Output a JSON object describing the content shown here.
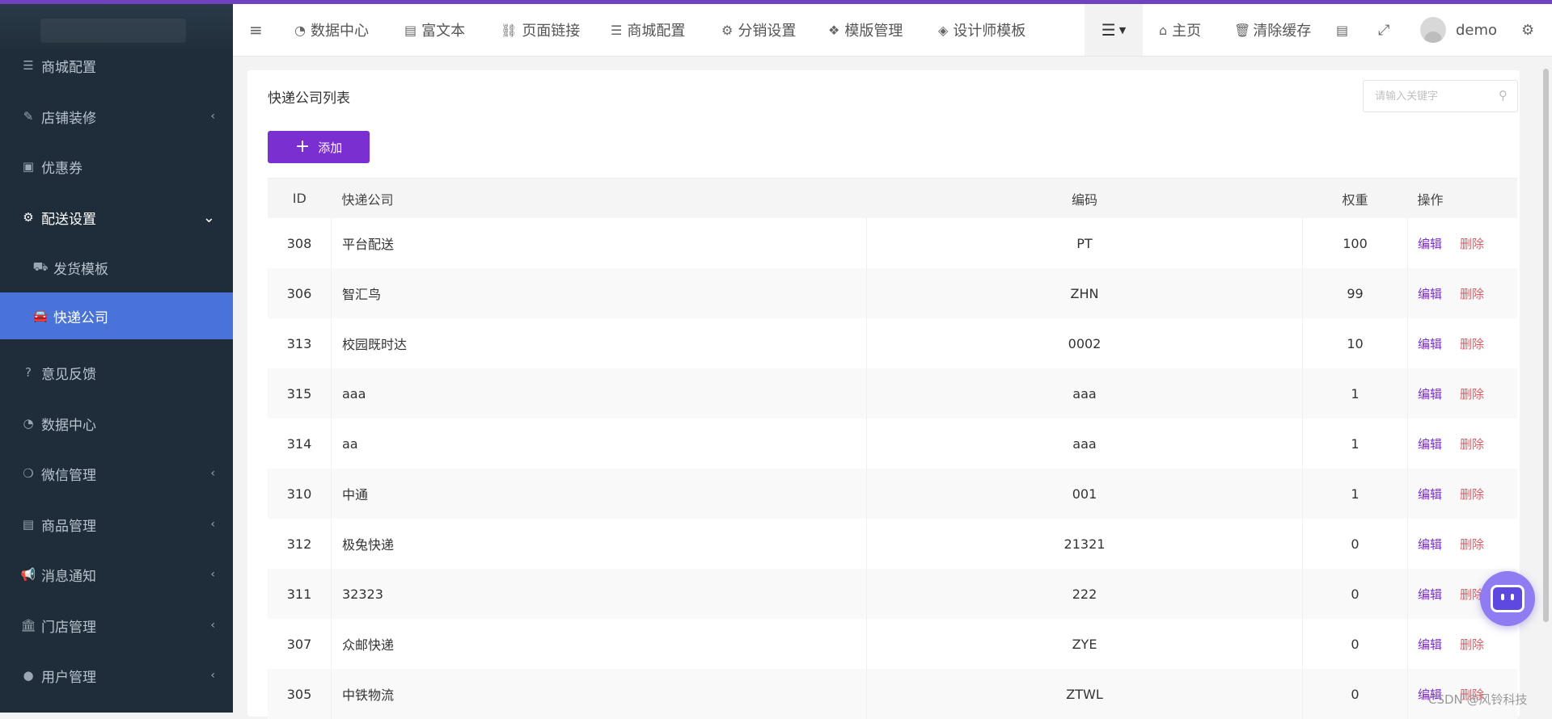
{
  "sidebar": {
    "items": [
      {
        "label": "商城配置",
        "icon": "sliders-icon",
        "chevron": ""
      },
      {
        "label": "店铺装修",
        "icon": "brush-icon",
        "chevron": "‹"
      },
      {
        "label": "优惠券",
        "icon": "money-icon",
        "chevron": ""
      },
      {
        "label": "配送设置",
        "icon": "cogs-icon",
        "chevron": "⌄"
      },
      {
        "label": "发货模板",
        "icon": "ambulance-icon",
        "chevron": ""
      },
      {
        "label": "快递公司",
        "icon": "car-icon",
        "chevron": ""
      },
      {
        "label": "意见反馈",
        "icon": "question-icon",
        "chevron": ""
      },
      {
        "label": "数据中心",
        "icon": "dashboard-icon",
        "chevron": ""
      },
      {
        "label": "微信管理",
        "icon": "wechat-icon",
        "chevron": "‹"
      },
      {
        "label": "商品管理",
        "icon": "archive-icon",
        "chevron": "‹"
      },
      {
        "label": "消息通知",
        "icon": "bullhorn-icon",
        "chevron": "‹"
      },
      {
        "label": "门店管理",
        "icon": "bank-icon",
        "chevron": "‹"
      },
      {
        "label": "用户管理",
        "icon": "user-icon",
        "chevron": "‹"
      }
    ]
  },
  "navbar": {
    "items": [
      {
        "label": "数据中心",
        "icon": "dashboard-icon"
      },
      {
        "label": "富文本",
        "icon": "file-word-icon"
      },
      {
        "label": "页面链接",
        "icon": "chain-icon"
      },
      {
        "label": "商城配置",
        "icon": "sliders-icon"
      },
      {
        "label": "分销设置",
        "icon": "gear-icon"
      },
      {
        "label": "模版管理",
        "icon": "cubes-icon"
      },
      {
        "label": "设计师模板",
        "icon": "cube-icon"
      }
    ],
    "home_label": "主页",
    "clear_cache_label": "清除缓存",
    "user_name": "demo"
  },
  "panel": {
    "title": "快递公司列表",
    "search_placeholder": "请输入关键字",
    "add_label": "添加"
  },
  "table": {
    "headers": {
      "id": "ID",
      "name": "快递公司",
      "code": "编码",
      "weight": "权重",
      "ops": "操作"
    },
    "edit_label": "编辑",
    "delete_label": "删除",
    "rows": [
      {
        "id": "308",
        "name": "平台配送",
        "code": "PT",
        "weight": "100"
      },
      {
        "id": "306",
        "name": "智汇鸟",
        "code": "ZHN",
        "weight": "99"
      },
      {
        "id": "313",
        "name": "校园既时达",
        "code": "0002",
        "weight": "10"
      },
      {
        "id": "315",
        "name": "aaa",
        "code": "aaa",
        "weight": "1"
      },
      {
        "id": "314",
        "name": "aa",
        "code": "aaa",
        "weight": "1"
      },
      {
        "id": "310",
        "name": "中通",
        "code": "001",
        "weight": "1"
      },
      {
        "id": "312",
        "name": "极兔快递",
        "code": "21321",
        "weight": "0"
      },
      {
        "id": "311",
        "name": "32323",
        "code": "222",
        "weight": "0"
      },
      {
        "id": "307",
        "name": "众邮快递",
        "code": "ZYE",
        "weight": "0"
      },
      {
        "id": "305",
        "name": "中铁物流",
        "code": "ZTWL",
        "weight": "0"
      }
    ]
  },
  "watermark": "CSDN @风铃科技",
  "colors": {
    "accent": "#7a2fd1",
    "sidebar_bg": "#1f2d3a",
    "sidebar_active": "#4a73d9",
    "delete": "#e15b64"
  }
}
